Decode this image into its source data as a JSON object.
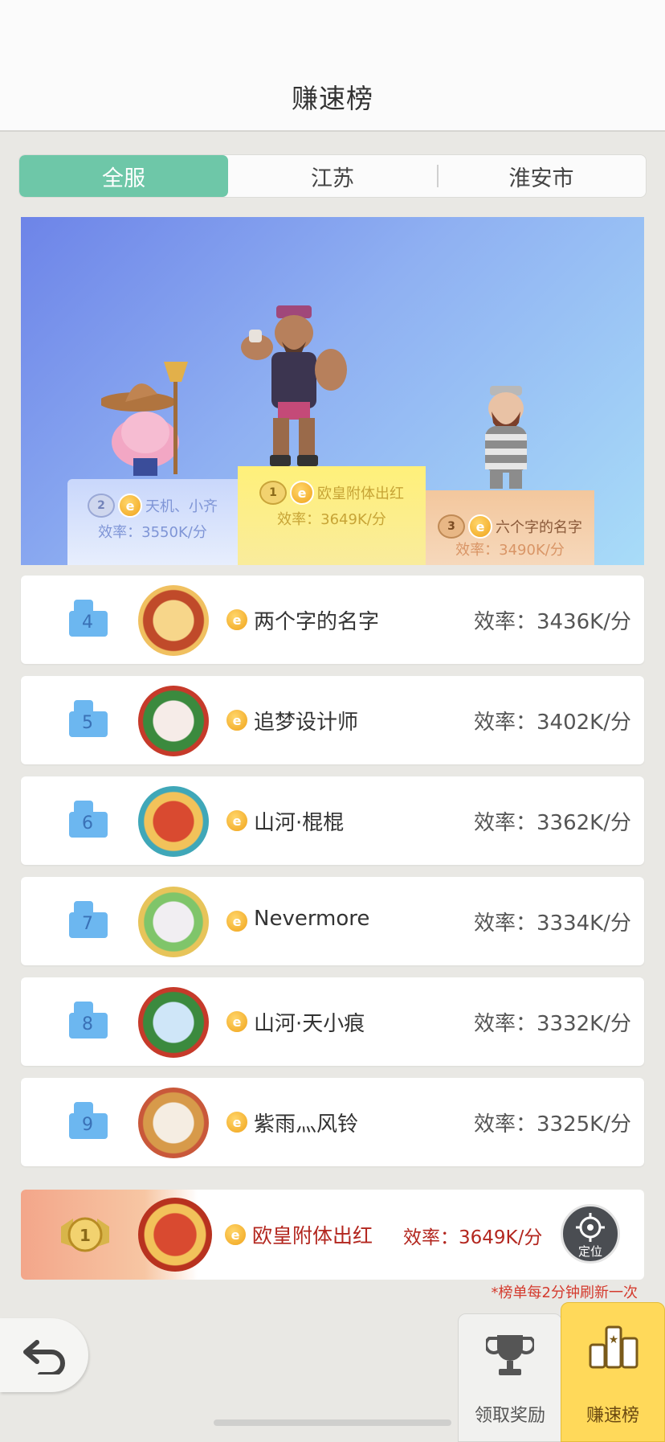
{
  "header": {
    "title": "赚速榜"
  },
  "tabs": [
    {
      "label": "全服"
    },
    {
      "label": "江苏"
    },
    {
      "label": "淮安市"
    }
  ],
  "podium": {
    "second": {
      "rank": "2",
      "name": "天机、小齐",
      "efficiency": "效率：3550K/分"
    },
    "first": {
      "rank": "1",
      "name": "欧皇附体出红",
      "efficiency": "效率：3649K/分"
    },
    "third": {
      "rank": "3",
      "name": "六个字的名字",
      "efficiency": "效率：3490K/分"
    }
  },
  "rows": [
    {
      "rank": "4",
      "name": "两个字的名字",
      "efficiency": "效率：3436K/分"
    },
    {
      "rank": "5",
      "name": "追梦设计师",
      "efficiency": "效率：3402K/分"
    },
    {
      "rank": "6",
      "name": "山河·棍棍",
      "efficiency": "效率：3362K/分"
    },
    {
      "rank": "7",
      "name": "Nevermore",
      "efficiency": "效率：3334K/分"
    },
    {
      "rank": "8",
      "name": "山河·天小痕",
      "efficiency": "效率：3332K/分"
    },
    {
      "rank": "9",
      "name": "紫雨灬风铃",
      "efficiency": "效率：3325K/分"
    }
  ],
  "my_rank": {
    "rank": "1",
    "name": "欧皇附体出红",
    "efficiency": "效率：3649K/分",
    "locate_label": "定位"
  },
  "note": "*榜单每2分钟刷新一次",
  "bottom_nav": {
    "reward_label": "领取奖励",
    "rank_label": "赚速榜"
  },
  "colors": {
    "accent_green": "#6ec7a8",
    "highlight_red": "#b3271f",
    "nav_active": "#ffd95a"
  }
}
